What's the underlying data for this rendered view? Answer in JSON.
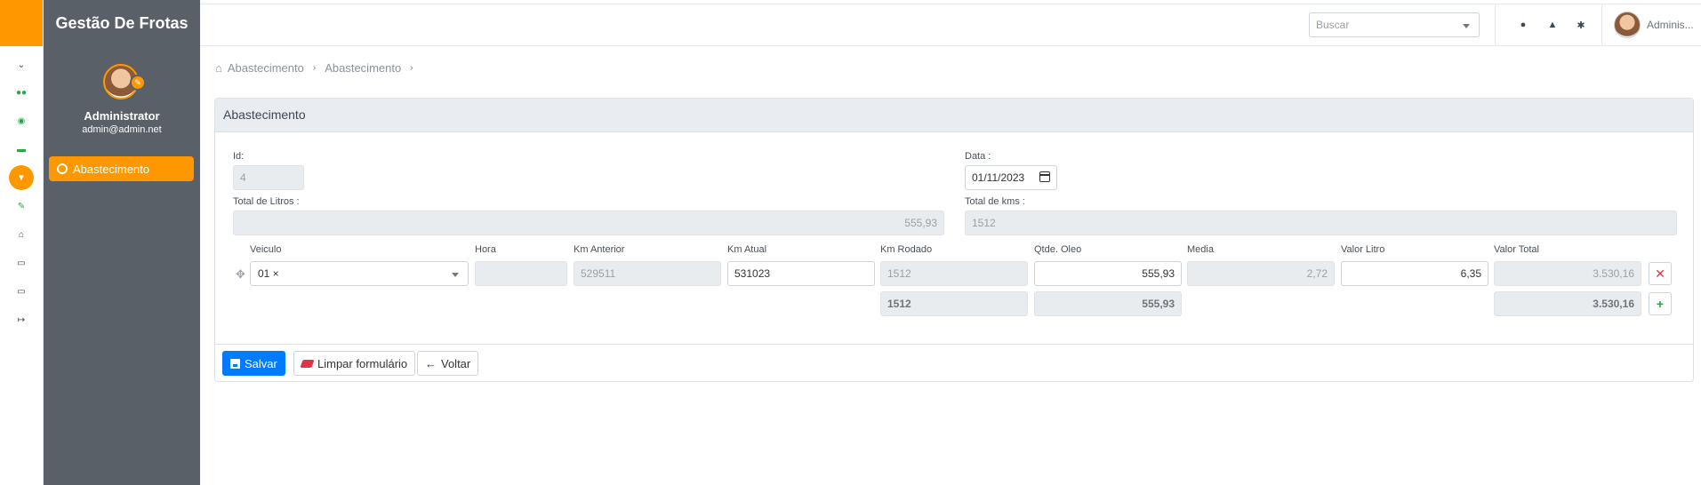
{
  "app": {
    "title": "Gestão De Frotas",
    "accent": "#ff9800",
    "primary": "#007bff",
    "sidebar_bg": "#596068"
  },
  "user": {
    "name": "Administrator",
    "email": "admin@admin.net",
    "short_name": "Adminis..."
  },
  "rail": {
    "items": [
      "chevron-down-icon",
      "users-icon",
      "dashboard-icon",
      "car-icon",
      "filter-icon",
      "wrench-icon",
      "home-icon",
      "document-icon",
      "monitor-icon",
      "logout-icon"
    ]
  },
  "sidebar": {
    "items": [
      {
        "label": "Abastecimento"
      }
    ]
  },
  "topbar": {
    "search_placeholder": "Buscar",
    "icons": [
      "comment-icon",
      "bell-icon",
      "cogs-icon"
    ]
  },
  "breadcrumb": [
    "Abastecimento",
    "Abastecimento"
  ],
  "form": {
    "title": "Abastecimento",
    "id_label": "Id:",
    "id_value": "4",
    "date_label": "Data :",
    "date_value": "01/11/2023",
    "total_litros_label": "Total de Litros :",
    "total_litros_value": "555,93",
    "total_kms_label": "Total de kms :",
    "total_kms_value": "1512",
    "columns": [
      "Veiculo",
      "Hora",
      "Km Anterior",
      "Km Atual",
      "Km Rodado",
      "Qtde. Oleo",
      "Media",
      "Valor Litro",
      "Valor Total"
    ],
    "row": {
      "veiculo": "01 ×",
      "hora": "",
      "km_anterior": "529511",
      "km_atual": "531023",
      "km_rodado": "1512",
      "qtde_oleo": "555,93",
      "media": "2,72",
      "valor_litro": "6,35",
      "valor_total": "3.530,16"
    },
    "totals": {
      "km_rodado": "1512",
      "qtde_oleo": "555,93",
      "valor_total": "3.530,16"
    },
    "buttons": {
      "save": "Salvar",
      "clear": "Limpar formulário",
      "back": "Voltar"
    }
  }
}
